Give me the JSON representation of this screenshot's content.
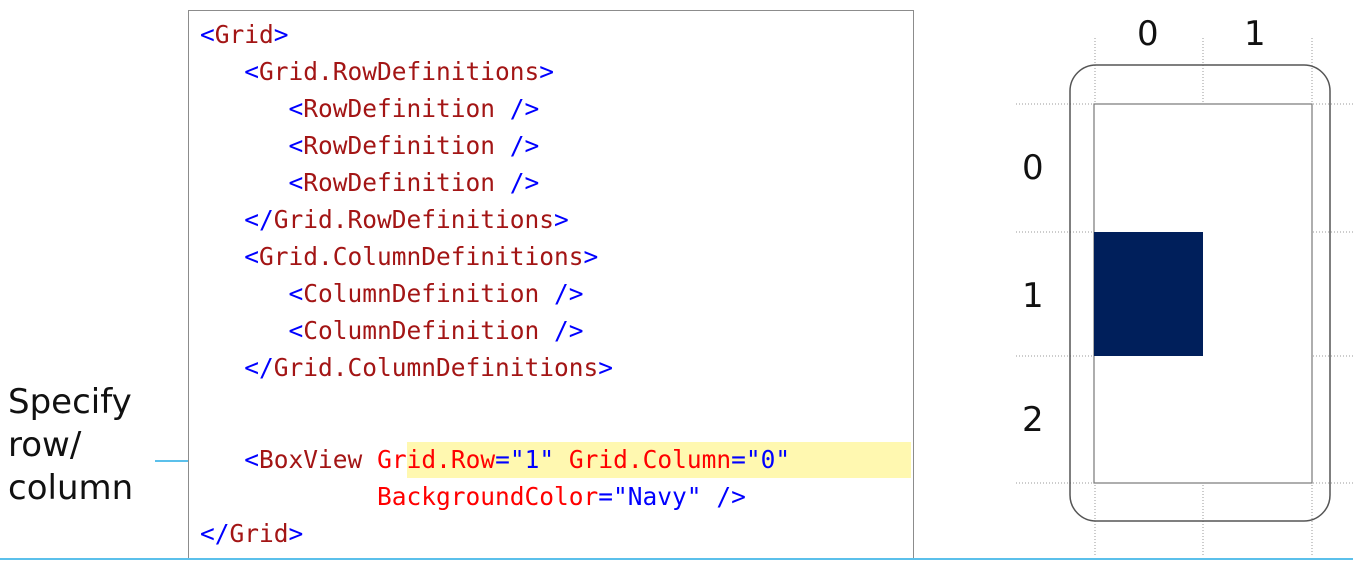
{
  "callout": {
    "lines": [
      "Specify",
      "row/",
      "column"
    ]
  },
  "code": {
    "l1_tag": "Grid",
    "l2_tag": "Grid.RowDefinitions",
    "l3_tag": "RowDefinition",
    "l4_tag": "RowDefinition",
    "l5_tag": "RowDefinition",
    "l6_tag": "Grid.RowDefinitions",
    "l7_tag": "Grid.ColumnDefinitions",
    "l8_tag": "ColumnDefinition",
    "l9_tag": "ColumnDefinition",
    "l10_tag": "Grid.ColumnDefinitions",
    "l11_tag": "BoxView",
    "l11_attr1": "Grid.Row",
    "l11_val1": "\"1\"",
    "l11_attr2": "Grid.Column",
    "l11_val2": "\"0\"",
    "l12_attr": "BackgroundColor",
    "l12_val": "\"Navy\"",
    "l13_tag": "Grid"
  },
  "preview": {
    "column_labels": [
      "0",
      "1"
    ],
    "row_labels": [
      "0",
      "1",
      "2"
    ],
    "box_row": 1,
    "box_column": 0,
    "box_color": "#001f5b"
  },
  "colors": {
    "tag": "#a31515",
    "punctuation": "#0000ff",
    "attribute": "#ff0000",
    "highlight": "#fff8b0",
    "arrow": "#5bc0eb"
  }
}
